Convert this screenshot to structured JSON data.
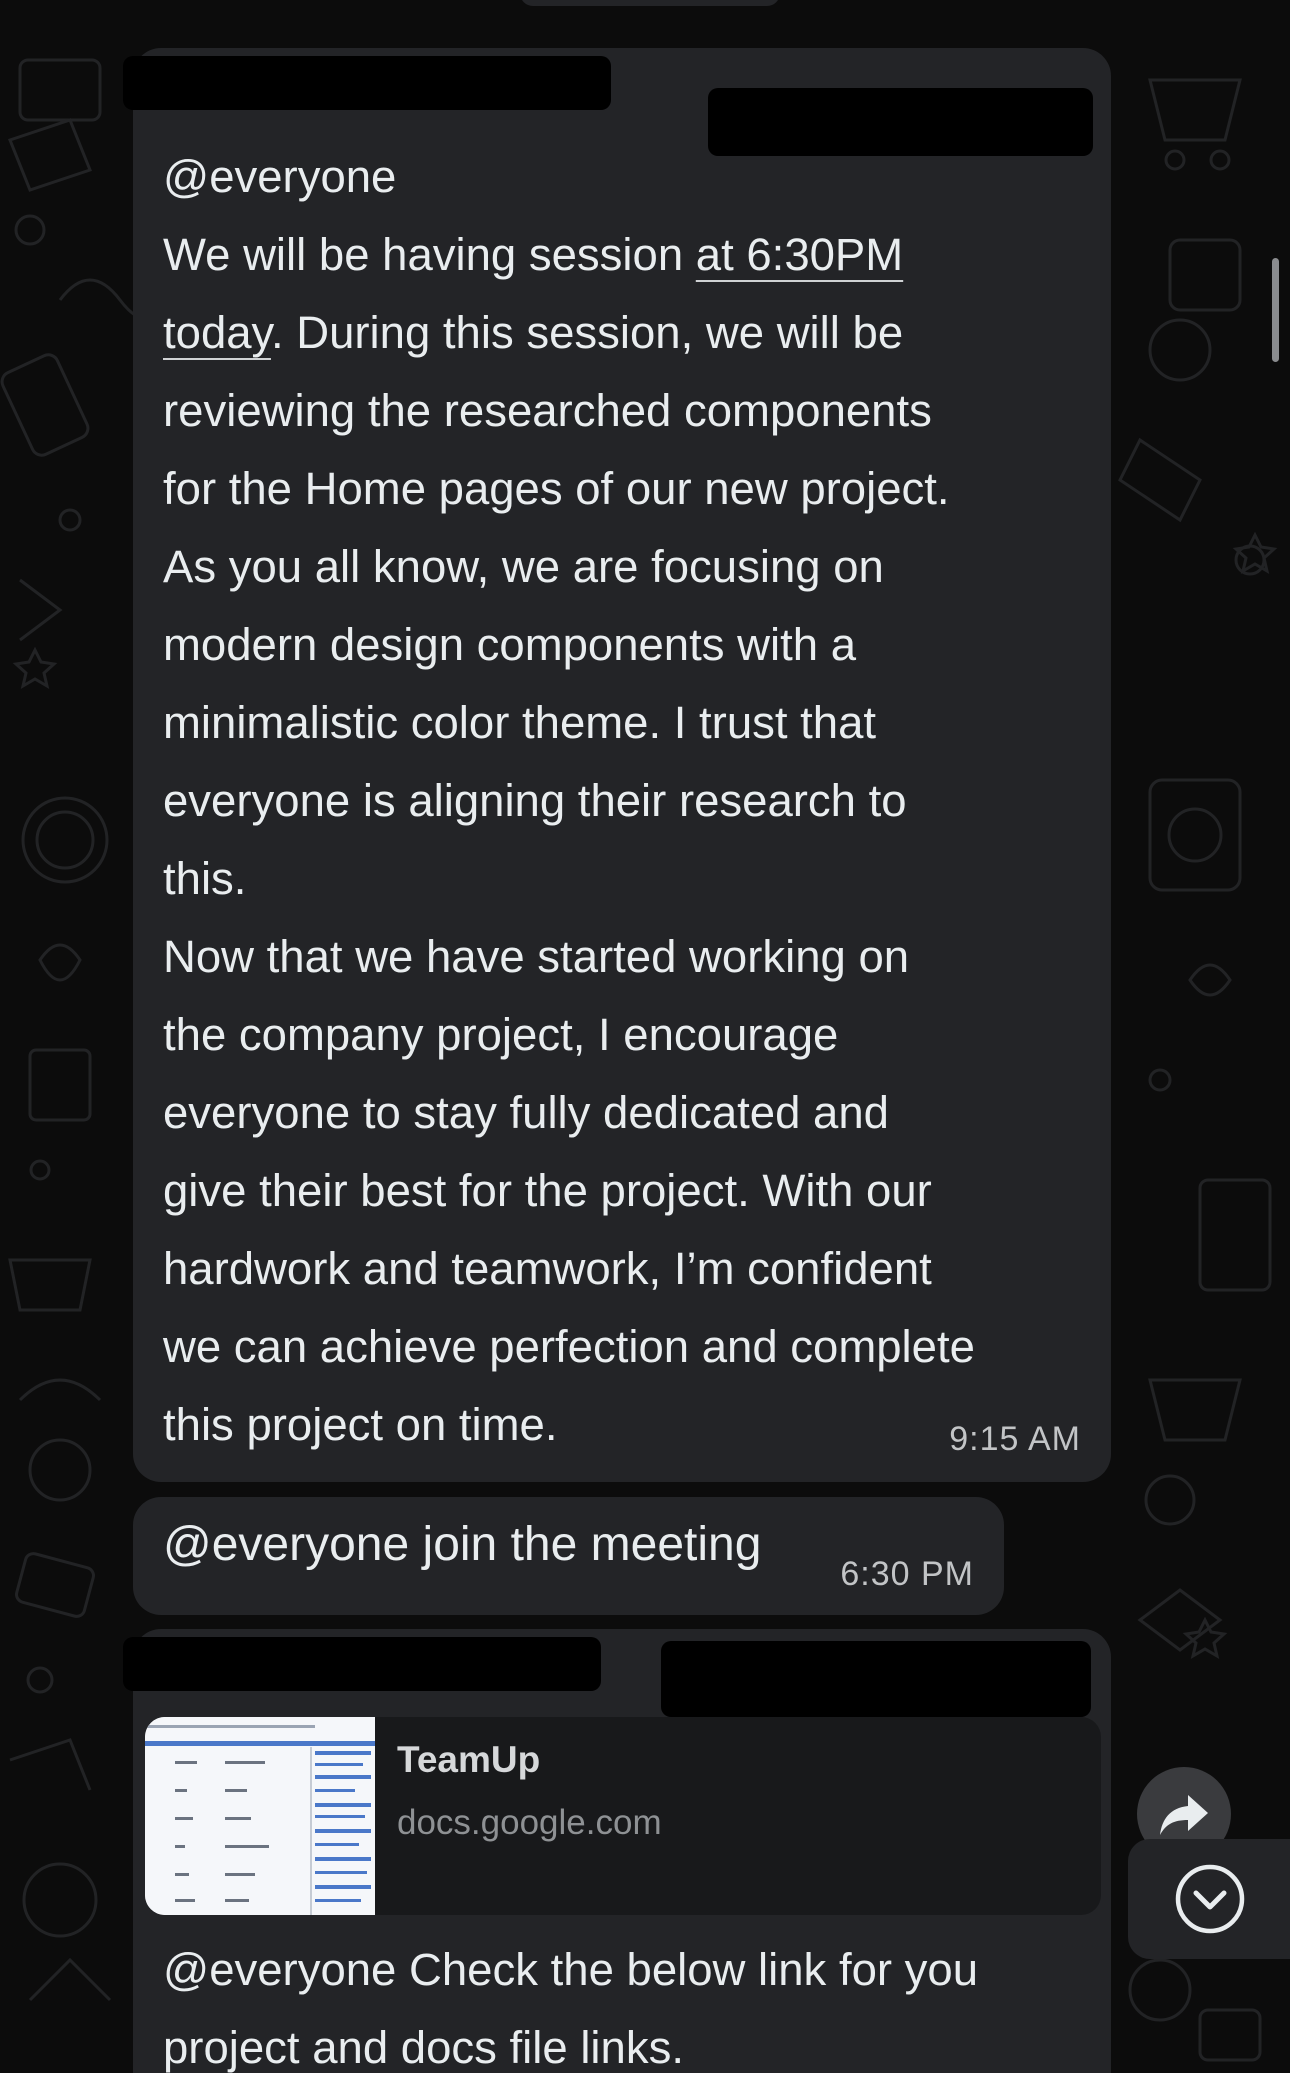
{
  "messages": [
    {
      "mention": "@everyone",
      "line1_pre": "We will be having session ",
      "line1_link": "at 6:30PM",
      "line2_link": "today",
      "line2_post": ". During this session, we will be",
      "body": "reviewing the researched components\nfor the Home pages of our new project.\nAs you all know, we are focusing on\nmodern design components with a\nminimalistic color theme. I trust that\neveryone is aligning their research to\nthis.\nNow that we have started working on\nthe company project, I encourage\neveryone to stay fully dedicated and\ngive their best for the project. With our\nhardwork and teamwork, I’m confident\nwe can achieve perfection and complete\nthis project on time.",
      "time": "9:15 AM"
    },
    {
      "text": "@everyone join the meeting",
      "time": "6:30 PM"
    },
    {
      "link_preview": {
        "title": "TeamUp",
        "domain": "docs.google.com",
        "thumbnail_icon": "document-thumbnail"
      },
      "text": "@everyone Check the below link for you\nproject and docs file links."
    }
  ],
  "icons": {
    "forward": "forward-arrow-icon",
    "scroll_down": "chevron-down-icon"
  },
  "colors": {
    "bubble": "#232427",
    "background": "#0c0c0c",
    "text": "#e9edef",
    "timestamp": "#c2c4c6"
  }
}
